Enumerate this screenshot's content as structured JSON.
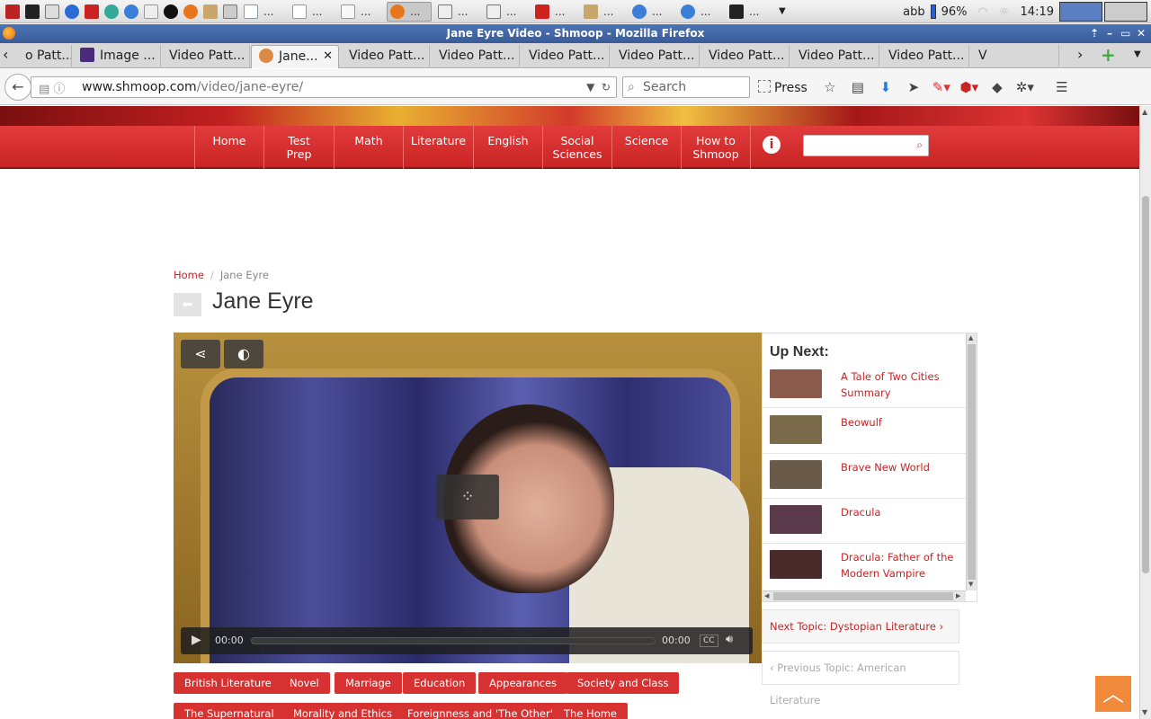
{
  "taskbar": {
    "task_dots": "...",
    "user": "abb",
    "battery": "96%",
    "time": "14:19"
  },
  "window": {
    "title": "Jane Eyre Video - Shmoop - Mozilla Firefox"
  },
  "tabs": [
    {
      "label": "o Patt..."
    },
    {
      "label": "Image ..."
    },
    {
      "label": "Video Patt..."
    },
    {
      "label": "Jane..."
    },
    {
      "label": "Video Patt..."
    },
    {
      "label": "Video Patt..."
    },
    {
      "label": "Video Patt..."
    },
    {
      "label": "Video Patt..."
    },
    {
      "label": "Video Patt..."
    },
    {
      "label": "Video Patt..."
    },
    {
      "label": "Video Patt..."
    },
    {
      "label": "V"
    }
  ],
  "urlbar": {
    "domain": "www.shmoop.com",
    "path": "/video/jane-eyre/"
  },
  "searchbar": {
    "placeholder": "Search"
  },
  "toolbar": {
    "press_label": "Press"
  },
  "site_nav": {
    "items": [
      "Home",
      "Test\nPrep",
      "Math",
      "Literature",
      "English",
      "Social\nSciences",
      "Science",
      "How to\nShmoop"
    ]
  },
  "breadcrumb": {
    "home": "Home",
    "sep": "/",
    "current": "Jane Eyre"
  },
  "page": {
    "title": "Jane Eyre"
  },
  "player": {
    "current_time": "00:00",
    "duration": "00:00",
    "cc": "CC"
  },
  "up_next": {
    "heading": "Up Next:",
    "items": [
      {
        "title": "A Tale of Two Cities Summary",
        "thumb_color": "#8a5b4a"
      },
      {
        "title": "Beowulf",
        "thumb_color": "#7a6a4a"
      },
      {
        "title": "Brave New World",
        "thumb_color": "#6a5a4a"
      },
      {
        "title": "Dracula",
        "thumb_color": "#5a3a4a"
      },
      {
        "title": "Dracula: Father of the Modern Vampire",
        "thumb_color": "#4a2a2a"
      }
    ]
  },
  "topics": {
    "next": "Next Topic: Dystopian Literature",
    "prev": "Previous Topic: American Literature"
  },
  "tags": [
    "British Literature",
    "Novel",
    "Marriage",
    "Education",
    "Appearances",
    "Society and Class",
    "The Supernatural",
    "Morality and Ethics",
    "Foreignness and 'The Other'",
    "The Home"
  ],
  "colors": {
    "brand_red": "#c92424",
    "tag_red": "#d63232",
    "to_top_orange": "#f08a3a"
  }
}
